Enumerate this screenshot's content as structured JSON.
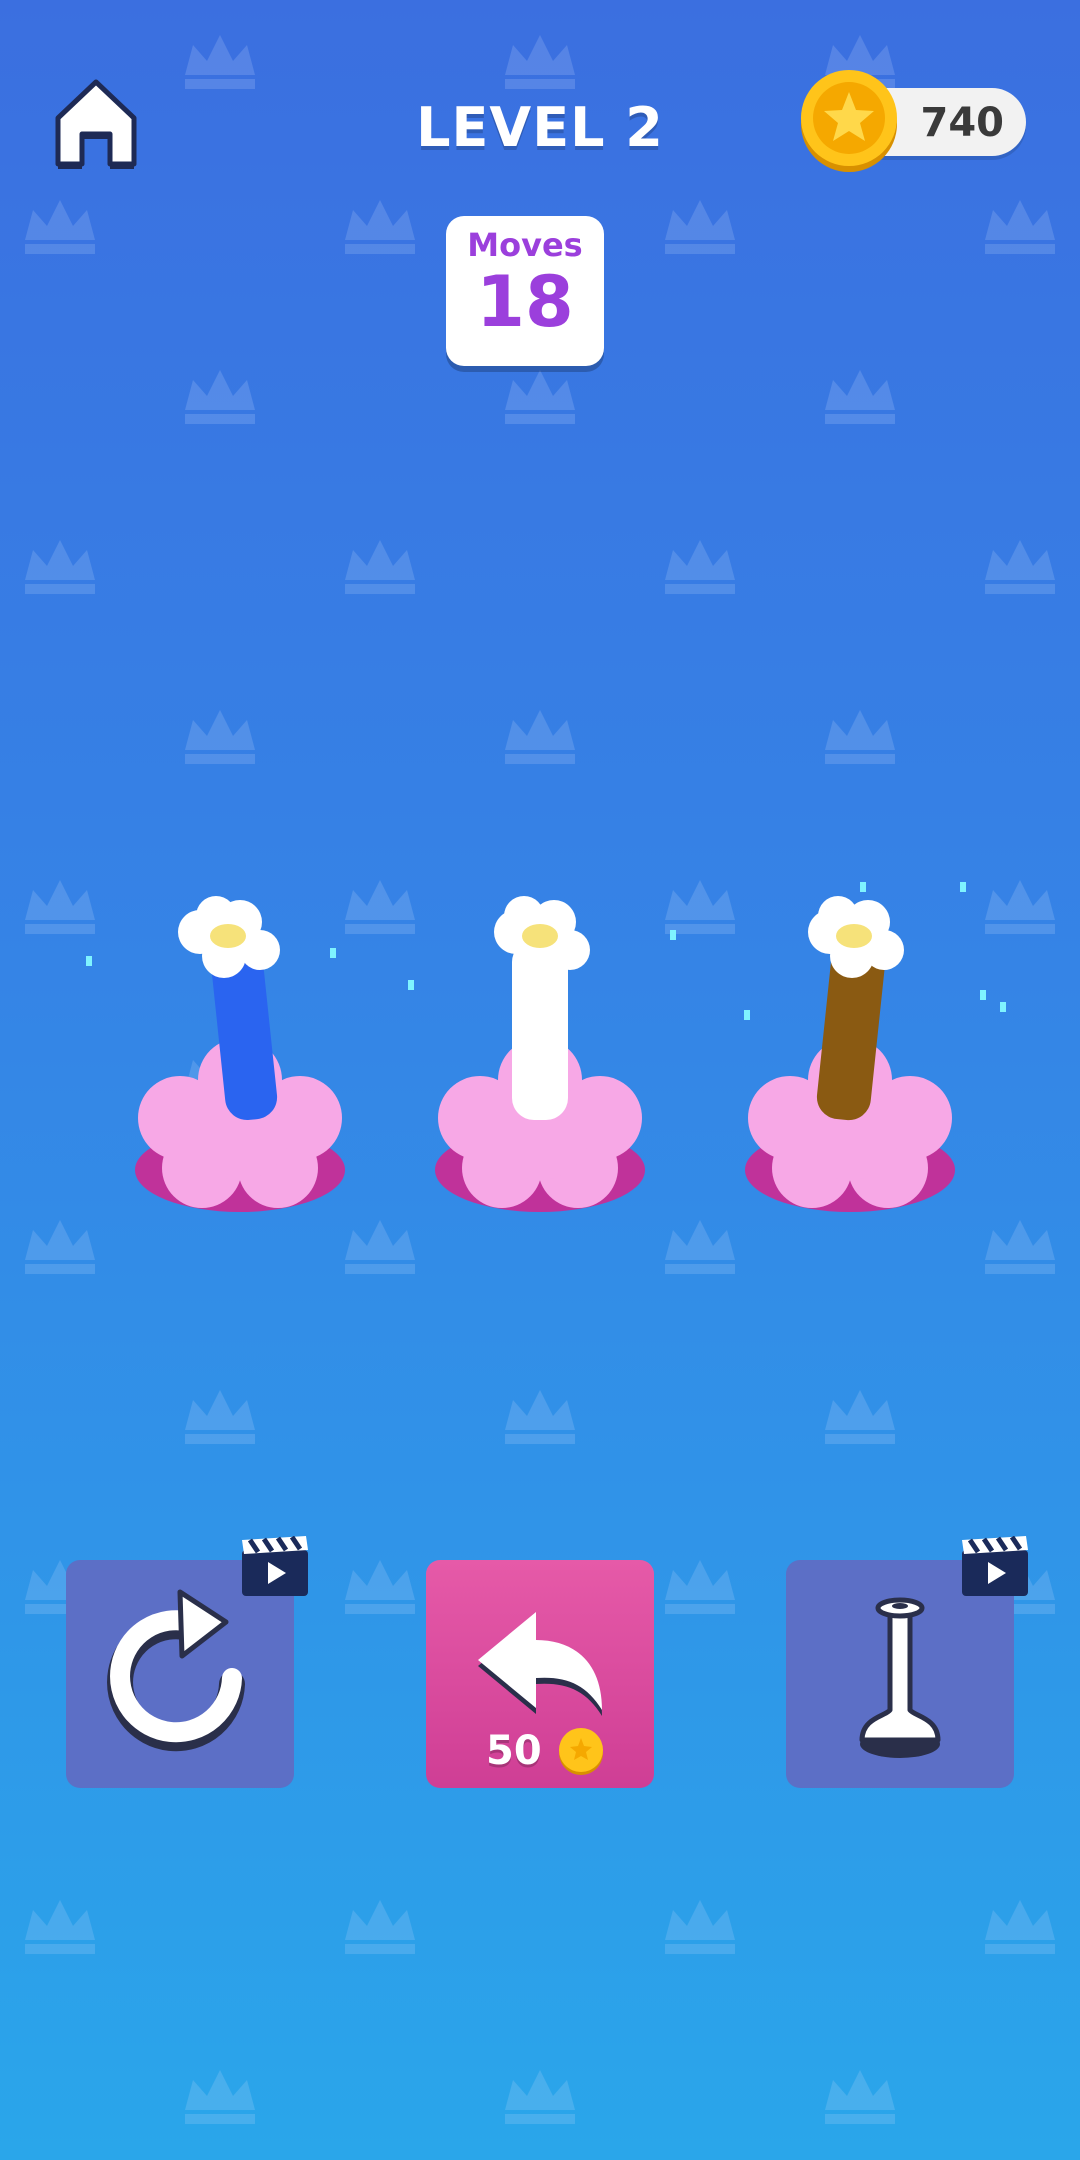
{
  "header": {
    "level_title": "LEVEL 2",
    "coins": "740"
  },
  "moves": {
    "label": "Moves",
    "value": "18"
  },
  "pegs": [
    {
      "name": "peg-blue",
      "color": "#2a64f0"
    },
    {
      "name": "peg-white",
      "color": "#ffffff"
    },
    {
      "name": "peg-brown",
      "color": "#8a5a12"
    }
  ],
  "actions": {
    "restart": {
      "icon": "restart-icon",
      "video_ad": true
    },
    "undo": {
      "icon": "undo-arrow-icon",
      "cost": "50"
    },
    "extra_pole": {
      "icon": "add-pole-icon",
      "video_ad": true
    }
  },
  "colors": {
    "accent_purple": "#9b3fdc",
    "undo_pink": "#d9449c",
    "button_blue": "#5c6fc6",
    "flower_pink": "#f39be0",
    "coin_gold": "#f5b800"
  }
}
